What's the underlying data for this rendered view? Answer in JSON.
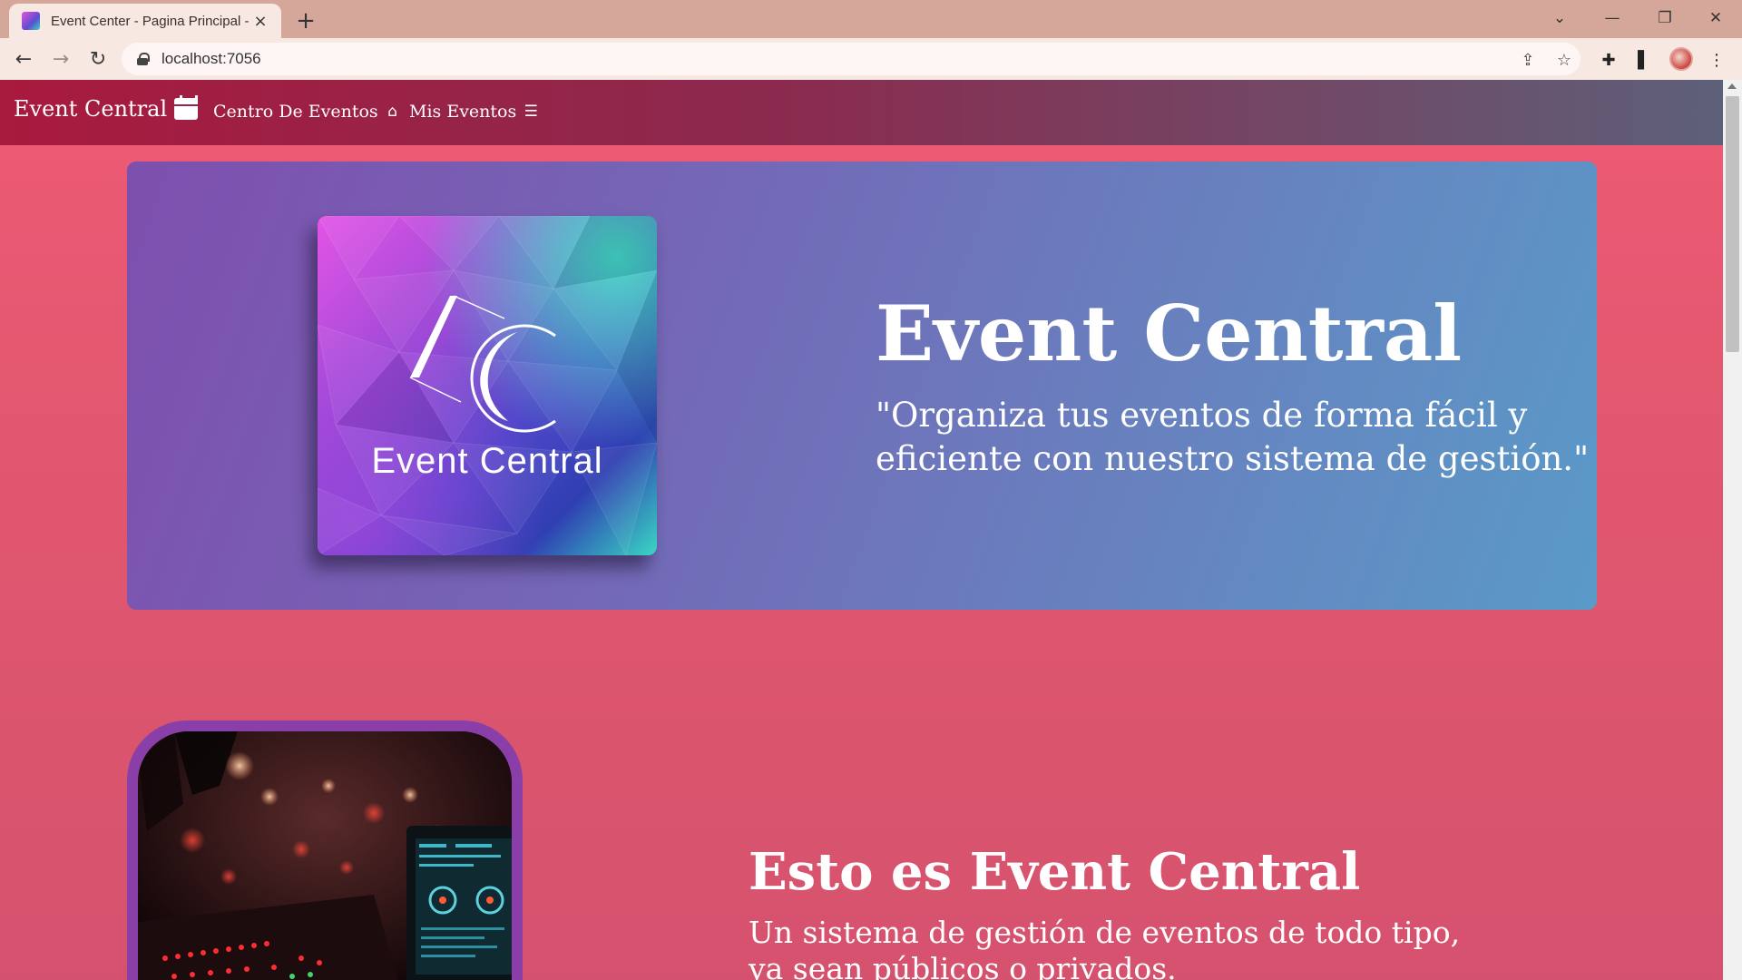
{
  "browser": {
    "tab_title": "Event Center - Pagina Principal - Event Central",
    "tab_close_icon": "×",
    "new_tab_icon": "+",
    "url": "localhost:7056",
    "window_controls": {
      "tab_search": "⌄",
      "minimize": "—",
      "restore": "❐",
      "close": "✕"
    }
  },
  "navbar": {
    "brand": "Event Central",
    "brand_icon": "calendar-icon",
    "links": [
      {
        "label": "Centro De Eventos",
        "icon": "house-icon",
        "glyph": "⌂"
      },
      {
        "label": "Mis Eventos",
        "icon": "list-icon",
        "glyph": "☰"
      }
    ]
  },
  "hero": {
    "logo_text": "Event Central",
    "logo_mark": "EC",
    "title": "Event Central",
    "subtitle": "\"Organiza tus eventos de forma fácil y eficiente con nuestro sistema de gestión.\""
  },
  "section": {
    "title": "Esto es Event Central",
    "subtitle": "Un sistema de gestión de eventos de todo tipo, ya sean públicos o privados."
  },
  "colors": {
    "page_bg": "#e5566f",
    "navbar_start": "#a81a3e",
    "navbar_end": "#5d6079",
    "hero_start": "#7e4fae",
    "hero_end": "#5a9ac8",
    "photo_frame": "#8a3fa8"
  }
}
